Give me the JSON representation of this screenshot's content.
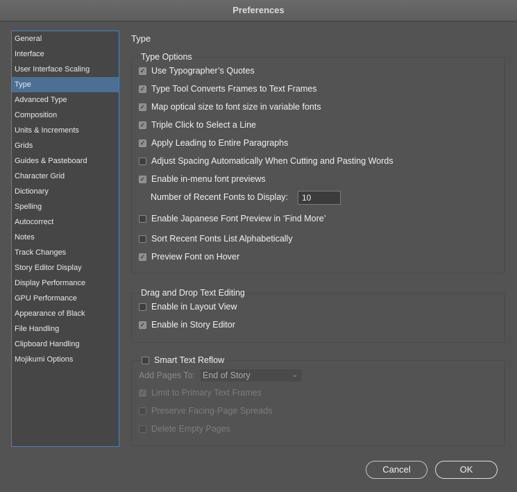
{
  "window": {
    "title": "Preferences"
  },
  "sidebar": {
    "items": [
      {
        "label": "General",
        "selected": false
      },
      {
        "label": "Interface",
        "selected": false
      },
      {
        "label": "User Interface Scaling",
        "selected": false
      },
      {
        "label": "Type",
        "selected": true
      },
      {
        "label": "Advanced Type",
        "selected": false
      },
      {
        "label": "Composition",
        "selected": false
      },
      {
        "label": "Units & Increments",
        "selected": false
      },
      {
        "label": "Grids",
        "selected": false
      },
      {
        "label": "Guides & Pasteboard",
        "selected": false
      },
      {
        "label": "Character Grid",
        "selected": false
      },
      {
        "label": "Dictionary",
        "selected": false
      },
      {
        "label": "Spelling",
        "selected": false
      },
      {
        "label": "Autocorrect",
        "selected": false
      },
      {
        "label": "Notes",
        "selected": false
      },
      {
        "label": "Track Changes",
        "selected": false
      },
      {
        "label": "Story Editor Display",
        "selected": false
      },
      {
        "label": "Display Performance",
        "selected": false
      },
      {
        "label": "GPU Performance",
        "selected": false
      },
      {
        "label": "Appearance of Black",
        "selected": false
      },
      {
        "label": "File Handling",
        "selected": false
      },
      {
        "label": "Clipboard Handling",
        "selected": false
      },
      {
        "label": "Mojikumi Options",
        "selected": false
      }
    ]
  },
  "main": {
    "section_title": "Type",
    "type_options": {
      "title": "Type Options",
      "options": [
        {
          "label": "Use Typographer’s Quotes",
          "checked": true
        },
        {
          "label": "Type Tool Converts Frames to Text Frames",
          "checked": true
        },
        {
          "label": "Map optical size to font size in variable fonts",
          "checked": true
        },
        {
          "label": "Triple Click to Select a Line",
          "checked": true
        },
        {
          "label": "Apply Leading to Entire Paragraphs",
          "checked": true
        },
        {
          "label": "Adjust Spacing Automatically When Cutting and Pasting Words",
          "checked": false
        },
        {
          "label": "Enable in-menu font previews",
          "checked": true
        },
        {
          "label": "Enable Japanese Font Preview in ‘Find More’",
          "checked": false
        },
        {
          "label": "Sort Recent Fonts List Alphabetically",
          "checked": false
        },
        {
          "label": "Preview Font on Hover",
          "checked": true
        }
      ],
      "recent_fonts_label": "Number of Recent Fonts to Display:",
      "recent_fonts_value": "10"
    },
    "drag_drop": {
      "title": "Drag and Drop Text Editing",
      "options": [
        {
          "label": "Enable in Layout View",
          "checked": false
        },
        {
          "label": "Enable in Story Editor",
          "checked": true
        }
      ]
    },
    "smart_reflow": {
      "label": "Smart Text Reflow",
      "checked": false,
      "add_pages_label": "Add Pages To:",
      "add_pages_value": "End of Story",
      "options": [
        {
          "label": "Limit to Primary Text Frames",
          "checked": true
        },
        {
          "label": "Preserve Facing-Page Spreads",
          "checked": false
        },
        {
          "label": "Delete Empty Pages",
          "checked": false
        }
      ]
    }
  },
  "buttons": {
    "cancel": "Cancel",
    "ok": "OK"
  },
  "colors": {
    "background": "#535353",
    "selection": "#4c6f95",
    "focus_border": "#3e88c8"
  }
}
